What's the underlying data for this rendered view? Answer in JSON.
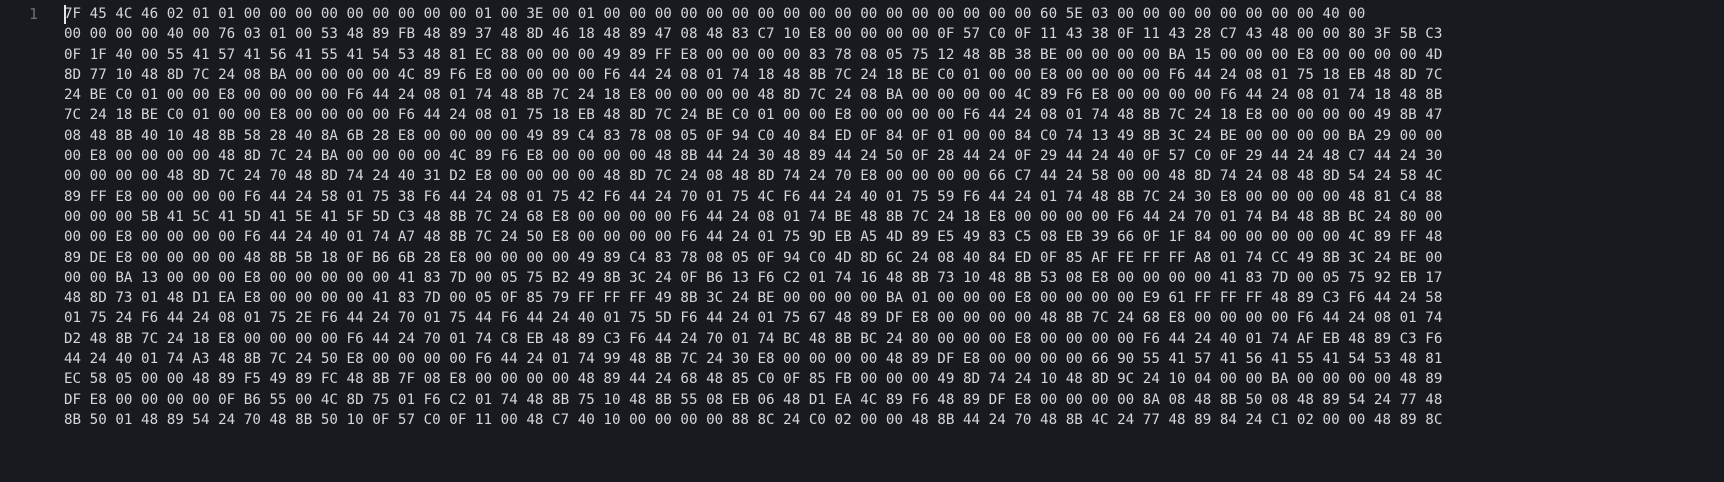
{
  "editor": {
    "line_number": "1",
    "hex_lines": [
      "7F 45 4C 46 02 01 01 00 00 00 00 00 00 00 00 00 01 00 3E 00 01 00 00 00 00 00 00 00 00 00 00 00 00 00 00 00 00 00 60 5E 03 00 00 00 00 00 00 00 00 40 00",
      "00 00 00 00 40 00 76 03 01 00 53 48 89 FB 48 89 37 48 8D 46 18 48 89 47 08 48 83 C7 10 E8 00 00 00 00 0F 57 C0 0F 11 43 38 0F 11 43 28 C7 43 48 00 00 80 3F 5B C3",
      "0F 1F 40 00 55 41 57 41 56 41 55 41 54 53 48 81 EC 88 00 00 00 49 89 FF E8 00 00 00 00 83 78 08 05 75 12 48 8B 38 BE 00 00 00 00 BA 15 00 00 00 E8 00 00 00 00 4D",
      "8D 77 10 48 8D 7C 24 08 BA 00 00 00 00 4C 89 F6 E8 00 00 00 00 F6 44 24 08 01 74 18 48 8B 7C 24 18 BE C0 01 00 00 E8 00 00 00 00 F6 44 24 08 01 75 18 EB 48 8D 7C",
      "24 BE C0 01 00 00 E8 00 00 00 00 F6 44 24 08 01 74 48 8B 7C 24 18 E8 00 00 00 00 48 8D 7C 24 08 BA 00 00 00 00 4C 89 F6 E8 00 00 00 00 F6 44 24 08 01 74 18 48 8B",
      "7C 24 18 BE C0 01 00 00 E8 00 00 00 00 F6 44 24 08 01 75 18 EB 48 8D 7C 24 BE C0 01 00 00 E8 00 00 00 00 F6 44 24 08 01 74 48 8B 7C 24 18 E8 00 00 00 00 49 8B 47",
      "08 48 8B 40 10 48 8B 58 28 40 8A 6B 28 E8 00 00 00 00 49 89 C4 83 78 08 05 0F 94 C0 40 84 ED 0F 84 0F 01 00 00 84 C0 74 13 49 8B 3C 24 BE 00 00 00 00 BA 29 00 00",
      "00 E8 00 00 00 00 48 8D 7C 24 BA 00 00 00 00 4C 89 F6 E8 00 00 00 00 48 8B 44 24 30 48 89 44 24 50 0F 28 44 24 0F 29 44 24 40 0F 57 C0 0F 29 44 24 48 C7 44 24 30",
      "00 00 00 00 48 8D 7C 24 70 48 8D 74 24 40 31 D2 E8 00 00 00 00 48 8D 7C 24 08 48 8D 74 24 70 E8 00 00 00 00 66 C7 44 24 58 00 00 48 8D 74 24 08 48 8D 54 24 58 4C",
      "89 FF E8 00 00 00 00 F6 44 24 58 01 75 38 F6 44 24 08 01 75 42 F6 44 24 70 01 75 4C F6 44 24 40 01 75 59 F6 44 24 01 74 48 8B 7C 24 30 E8 00 00 00 00 48 81 C4 88",
      "00 00 00 5B 41 5C 41 5D 41 5E 41 5F 5D C3 48 8B 7C 24 68 E8 00 00 00 00 F6 44 24 08 01 74 BE 48 8B 7C 24 18 E8 00 00 00 00 F6 44 24 70 01 74 B4 48 8B BC 24 80 00",
      "00 00 E8 00 00 00 00 F6 44 24 40 01 74 A7 48 8B 7C 24 50 E8 00 00 00 00 F6 44 24 01 75 9D EB A5 4D 89 E5 49 83 C5 08 EB 39 66 0F 1F 84 00 00 00 00 00 4C 89 FF 48",
      "89 DE E8 00 00 00 00 48 8B 5B 18 0F B6 6B 28 E8 00 00 00 00 49 89 C4 83 78 08 05 0F 94 C0 4D 8D 6C 24 08 40 84 ED 0F 85 AF FE FF FF A8 01 74 CC 49 8B 3C 24 BE 00",
      "00 00 BA 13 00 00 00 E8 00 00 00 00 00 41 83 7D 00 05 75 B2 49 8B 3C 24 0F B6 13 F6 C2 01 74 16 48 8B 73 10 48 8B 53 08 E8 00 00 00 00 41 83 7D 00 05 75 92 EB 17",
      "48 8D 73 01 48 D1 EA E8 00 00 00 00 41 83 7D 00 05 0F 85 79 FF FF FF 49 8B 3C 24 BE 00 00 00 00 BA 01 00 00 00 E8 00 00 00 00 E9 61 FF FF FF 48 89 C3 F6 44 24 58",
      "01 75 24 F6 44 24 08 01 75 2E F6 44 24 70 01 75 44 F6 44 24 40 01 75 5D F6 44 24 01 75 67 48 89 DF E8 00 00 00 00 48 8B 7C 24 68 E8 00 00 00 00 F6 44 24 08 01 74",
      "D2 48 8B 7C 24 18 E8 00 00 00 00 F6 44 24 70 01 74 C8 EB 48 89 C3 F6 44 24 70 01 74 BC 48 8B BC 24 80 00 00 00 E8 00 00 00 00 F6 44 24 40 01 74 AF EB 48 89 C3 F6",
      "44 24 40 01 74 A3 48 8B 7C 24 50 E8 00 00 00 00 F6 44 24 01 74 99 48 8B 7C 24 30 E8 00 00 00 00 48 89 DF E8 00 00 00 00 66 90 55 41 57 41 56 41 55 41 54 53 48 81",
      "EC 58 05 00 00 48 89 F5 49 89 FC 48 8B 7F 08 E8 00 00 00 00 48 89 44 24 68 48 85 C0 0F 85 FB 00 00 00 49 8D 74 24 10 48 8D 9C 24 10 04 00 00 BA 00 00 00 00 48 89",
      "DF E8 00 00 00 00 0F B6 55 00 4C 8D 75 01 F6 C2 01 74 48 8B 75 10 48 8B 55 08 EB 06 48 D1 EA 4C 89 F6 48 89 DF E8 00 00 00 00 8A 08 48 8B 50 08 48 89 54 24 77 48",
      "8B 50 01 48 89 54 24 70 48 8B 50 10 0F 57 C0 0F 11 00 48 C7 40 10 00 00 00 00 88 8C 24 C0 02 00 00 48 8B 44 24 70 48 8B 4C 24 77 48 89 84 24 C1 02 00 00 48 89 8C"
    ]
  }
}
